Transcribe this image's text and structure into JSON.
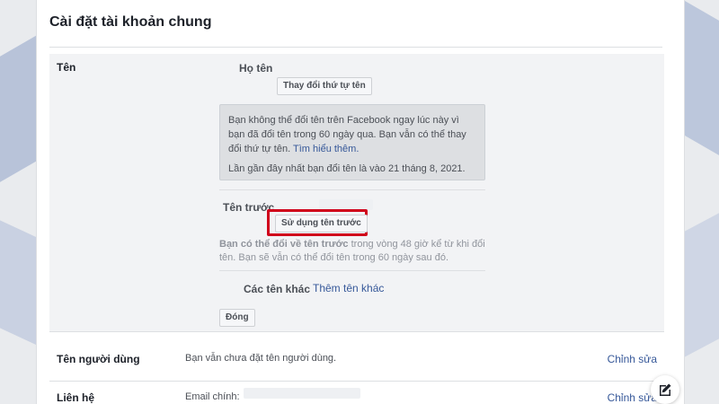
{
  "page": {
    "title": "Cài đặt tài khoản chung"
  },
  "name_section": {
    "label": "Tên",
    "full_name_label": "Họ tên",
    "reorder_button": "Thay đổi thứ tự tên",
    "notice": {
      "text": "Bạn không thể đổi tên trên Facebook ngay lúc này vì bạn đã đổi tên trong 60 ngày qua. Bạn vẫn có thể thay đổi thứ tự tên.",
      "link": "Tìm hiểu thêm.",
      "last_change": "Lần gần đây nhất bạn đổi tên là vào 21 tháng 8, 2021."
    },
    "previous_name_label": "Tên trước",
    "use_previous_button": "Sử dụng tên trước",
    "hint_bold": "Bạn có thể đổi về tên trước",
    "hint_rest": " trong vòng 48 giờ kể từ khi đổi tên. Bạn sẽ vẫn có thể đổi tên trong 60 ngày sau đó.",
    "other_names_label": "Các tên khác",
    "add_other_name_link": "Thêm tên khác",
    "close_button": "Đóng"
  },
  "rows": {
    "username": {
      "label": "Tên người dùng",
      "value": "Bạn vẫn chưa đặt tên người dùng.",
      "edit": "Chỉnh sửa"
    },
    "contact": {
      "label": "Liên hệ",
      "value": "Email chính:",
      "edit": "Chỉnh sửa"
    }
  },
  "colors": {
    "link": "#365899",
    "highlight": "#d0021b",
    "section_bg": "#f2f3f5"
  },
  "icons": {
    "fab": "edit-icon"
  }
}
